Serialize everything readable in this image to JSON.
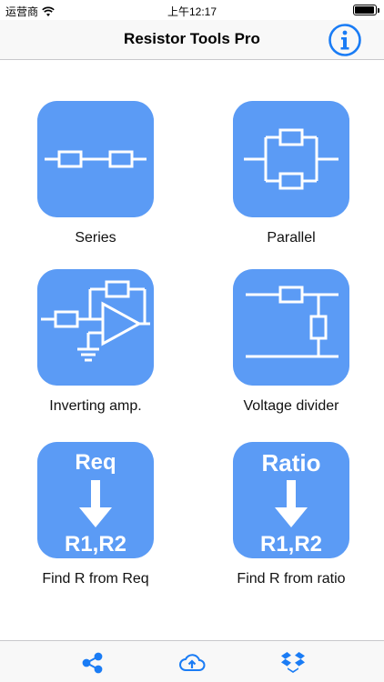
{
  "status_bar": {
    "carrier": "运营商",
    "time": "上午12:17"
  },
  "nav": {
    "title": "Resistor Tools Pro",
    "info_icon": "info-icon"
  },
  "colors": {
    "accent": "#1a7cf5",
    "tile": "#5b9bf5"
  },
  "tools": [
    {
      "label": "Series",
      "icon": "series-circuit-icon"
    },
    {
      "label": "Parallel",
      "icon": "parallel-circuit-icon"
    },
    {
      "label": "Inverting amp.",
      "icon": "inverting-amp-icon"
    },
    {
      "label": "Voltage divider",
      "icon": "voltage-divider-icon"
    },
    {
      "label": "Find R from Req",
      "icon": "req-to-r-icon",
      "top_text": "Req",
      "bottom_text": "R1,R2"
    },
    {
      "label": "Find R from ratio",
      "icon": "ratio-to-r-icon",
      "top_text": "Ratio",
      "bottom_text": "R1,R2"
    }
  ],
  "tab_bar": {
    "items": [
      "share-icon",
      "cloud-upload-icon",
      "dropbox-icon"
    ]
  }
}
